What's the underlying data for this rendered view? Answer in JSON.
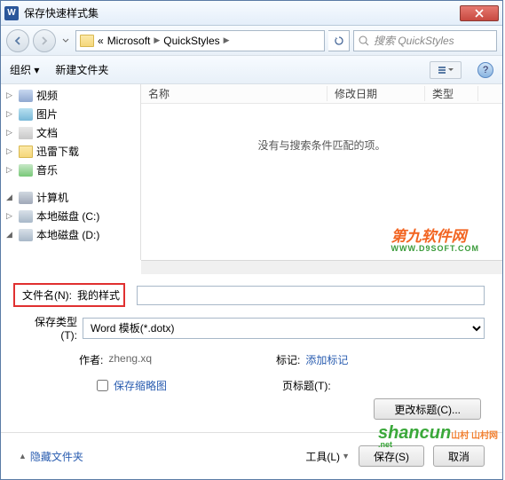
{
  "title": "保存快速样式集",
  "nav": {
    "breadcrumb_sep1": "«",
    "crumb1": "Microsoft",
    "crumb2": "QuickStyles",
    "search_placeholder": "搜索 QuickStyles"
  },
  "toolbar": {
    "organize": "组织 ▾",
    "new_folder": "新建文件夹"
  },
  "tree": {
    "video": "视频",
    "pictures": "图片",
    "documents": "文档",
    "xunlei": "迅雷下载",
    "music": "音乐",
    "computer": "计算机",
    "drive_c": "本地磁盘 (C:)",
    "drive_d": "本地磁盘 (D:)"
  },
  "list": {
    "col_name": "名称",
    "col_date": "修改日期",
    "col_type": "类型",
    "empty": "没有与搜索条件匹配的项。"
  },
  "watermark1": {
    "main": "第九软件网",
    "sub": "WWW.D9SOFT.COM"
  },
  "form": {
    "filename_label": "文件名(N):",
    "filename_value": "我的样式",
    "type_label": "保存类型(T):",
    "type_value": "Word 模板(*.dotx)"
  },
  "meta": {
    "author_label": "作者:",
    "author_value": "zheng.xq",
    "tag_label": "标记:",
    "tag_value": "添加标记"
  },
  "thumb": {
    "label": "保存缩略图",
    "page_title": "页标题(T):",
    "change_title": "更改标题(C)..."
  },
  "footer": {
    "hide_folders": "隐藏文件夹",
    "tools": "工具(L)",
    "save": "保存(S)",
    "cancel": "取消"
  },
  "watermark2": {
    "main": "shancun",
    "tag": "山村 山村网",
    "sub": ".net"
  }
}
